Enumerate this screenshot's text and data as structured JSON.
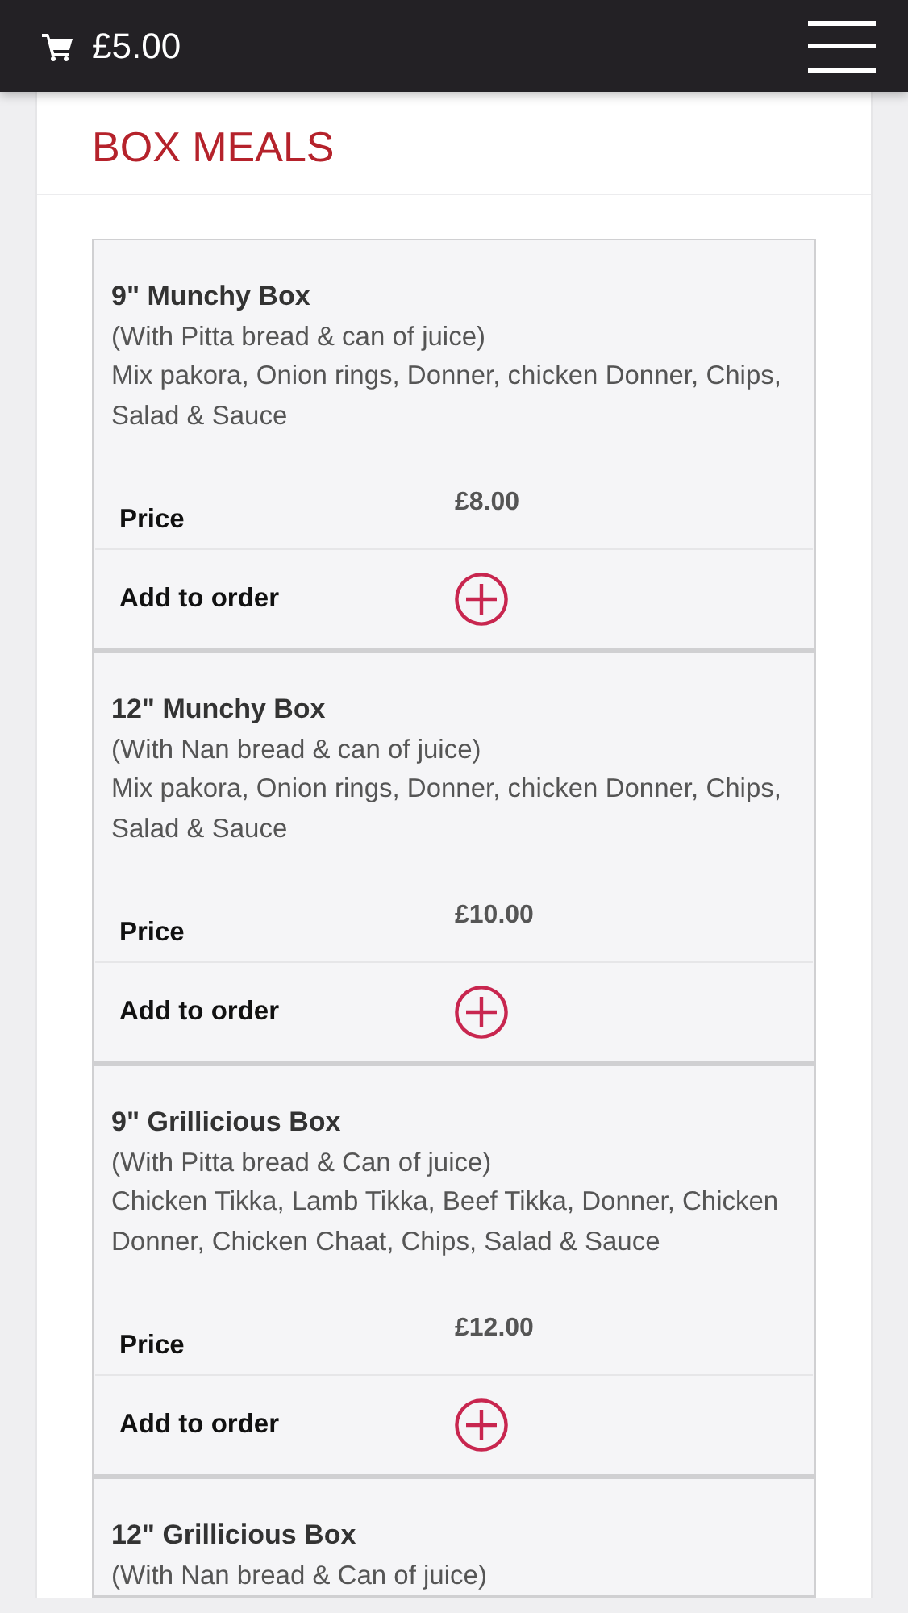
{
  "header": {
    "cart_total": "£5.00"
  },
  "section": {
    "title": "BOX MEALS"
  },
  "items": [
    {
      "name": "9\" Munchy Box",
      "subtitle": "(With Pitta bread & can of juice)",
      "description": "Mix pakora, Onion rings, Donner, chicken Donner, Chips, Salad & Sauce",
      "price_label": "Price",
      "price": "£8.00",
      "add_label": "Add to order"
    },
    {
      "name": "12\" Munchy Box",
      "subtitle": "(With Nan bread & can of juice)",
      "description": "Mix pakora, Onion rings, Donner, chicken Donner, Chips, Salad & Sauce",
      "price_label": "Price",
      "price": "£10.00",
      "add_label": "Add to order"
    },
    {
      "name": "9\" Grillicious Box",
      "subtitle": "(With Pitta bread & Can of juice)",
      "description": "Chicken Tikka, Lamb Tikka, Beef Tikka, Donner, Chicken Donner, Chicken Chaat, Chips, Salad & Sauce",
      "price_label": "Price",
      "price": "£12.00",
      "add_label": "Add to order"
    },
    {
      "name": "12\" Grillicious Box",
      "subtitle": "(With Nan bread & Can of juice)"
    }
  ]
}
